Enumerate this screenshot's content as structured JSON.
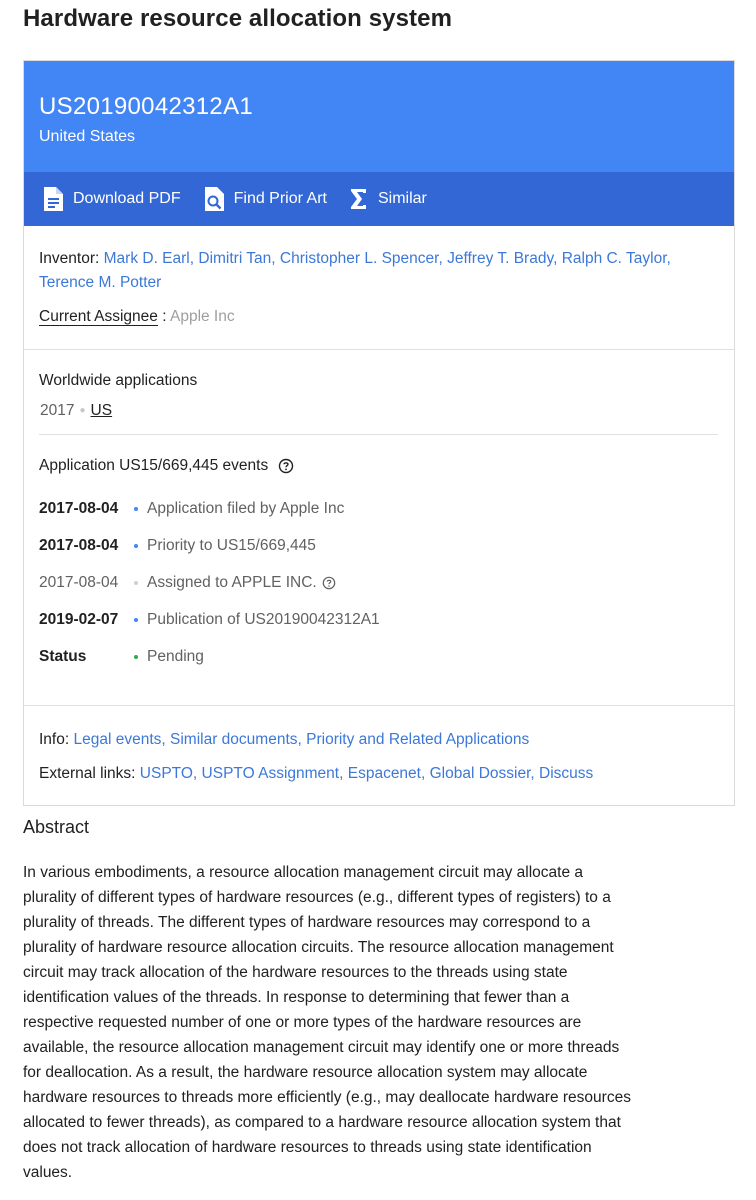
{
  "title": "Hardware resource allocation system",
  "header": {
    "publication_number": "US20190042312A1",
    "country": "United States"
  },
  "toolbar": {
    "download_label": "Download PDF",
    "prior_art_label": "Find Prior Art",
    "similar_label": "Similar"
  },
  "people": {
    "inventor_label": "Inventor:",
    "inventors": [
      "Mark D. Earl",
      "Dimitri Tan",
      "Christopher L. Spencer",
      "Jeffrey T. Brady",
      "Ralph C. Taylor",
      "Terence M. Potter"
    ],
    "assignee_label": "Current Assignee",
    "assignee_colon": " : ",
    "assignee": "Apple Inc"
  },
  "worldwide": {
    "title": "Worldwide applications",
    "year": "2017",
    "country": "US"
  },
  "events": {
    "title": "Application US15/669,445 events",
    "items": [
      {
        "date": "2017-08-04",
        "text": "Application filed by Apple Inc"
      },
      {
        "date": "2017-08-04",
        "text": "Priority to US15/669,445"
      },
      {
        "date": "2017-08-04",
        "text": "Assigned to APPLE INC."
      },
      {
        "date": "2019-02-07",
        "text": "Publication of US20190042312A1"
      },
      {
        "date": "Status",
        "text": "Pending"
      }
    ]
  },
  "info": {
    "label": "Info:",
    "links": [
      "Legal events",
      "Similar documents",
      "Priority and Related Applications"
    ]
  },
  "external": {
    "label": "External links:",
    "links": [
      "USPTO",
      "USPTO Assignment",
      "Espacenet",
      "Global Dossier",
      "Discuss"
    ]
  },
  "abstract": {
    "heading": "Abstract",
    "text": "In various embodiments, a resource allocation management circuit may allocate a plurality of different types of hardware resources (e.g., different types of registers) to a plurality of threads. The different types of hardware resources may correspond to a plurality of hardware resource allocation circuits. The resource allocation management circuit may track allocation of the hardware resources to the threads using state identification values of the threads. In response to determining that fewer than a respective requested number of one or more types of the hardware resources are available, the resource allocation management circuit may identify one or more threads for deallocation. As a result, the hardware resource allocation system may allocate hardware resources to threads more efficiently (e.g., may deallocate hardware resources allocated to fewer threads), as compared to a hardware resource allocation system that does not track allocation of hardware resources to threads using state identification values."
  },
  "colors": {
    "hero": "#4285f4",
    "toolbar": "#3367d6",
    "link": "#3c78d8"
  },
  "icons": {
    "download": "document-icon",
    "prior_art": "magnifier-document-icon",
    "similar": "sigma-icon",
    "help": "help-circle-icon"
  }
}
